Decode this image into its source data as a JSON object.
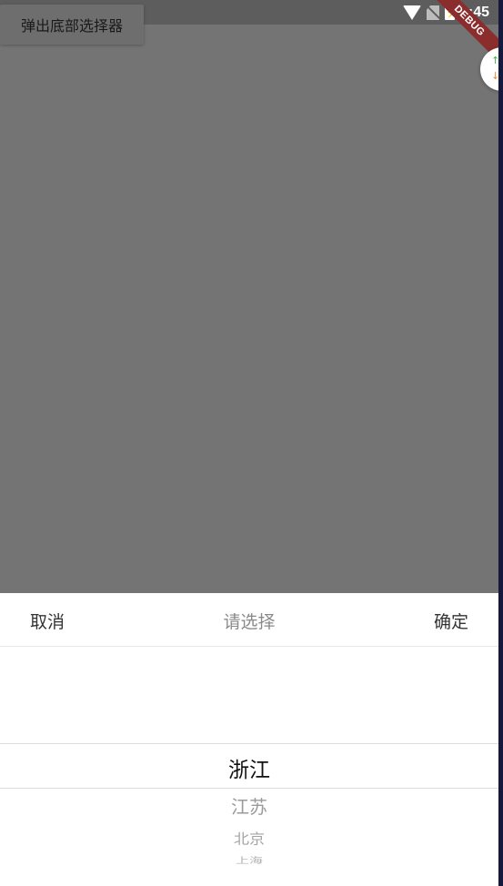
{
  "status_bar": {
    "time": "9:45",
    "debug_label": "DEBUG"
  },
  "top_button": {
    "label": "弹出底部选择器"
  },
  "sheet": {
    "cancel_label": "取消",
    "title": "请选择",
    "confirm_label": "确定",
    "picker_items": [
      "浙江",
      "江苏",
      "北京",
      "上海"
    ],
    "selected_index": 0
  },
  "float_handle": {
    "up_icon": "arrow-up-icon",
    "down_icon": "arrow-down-icon"
  }
}
